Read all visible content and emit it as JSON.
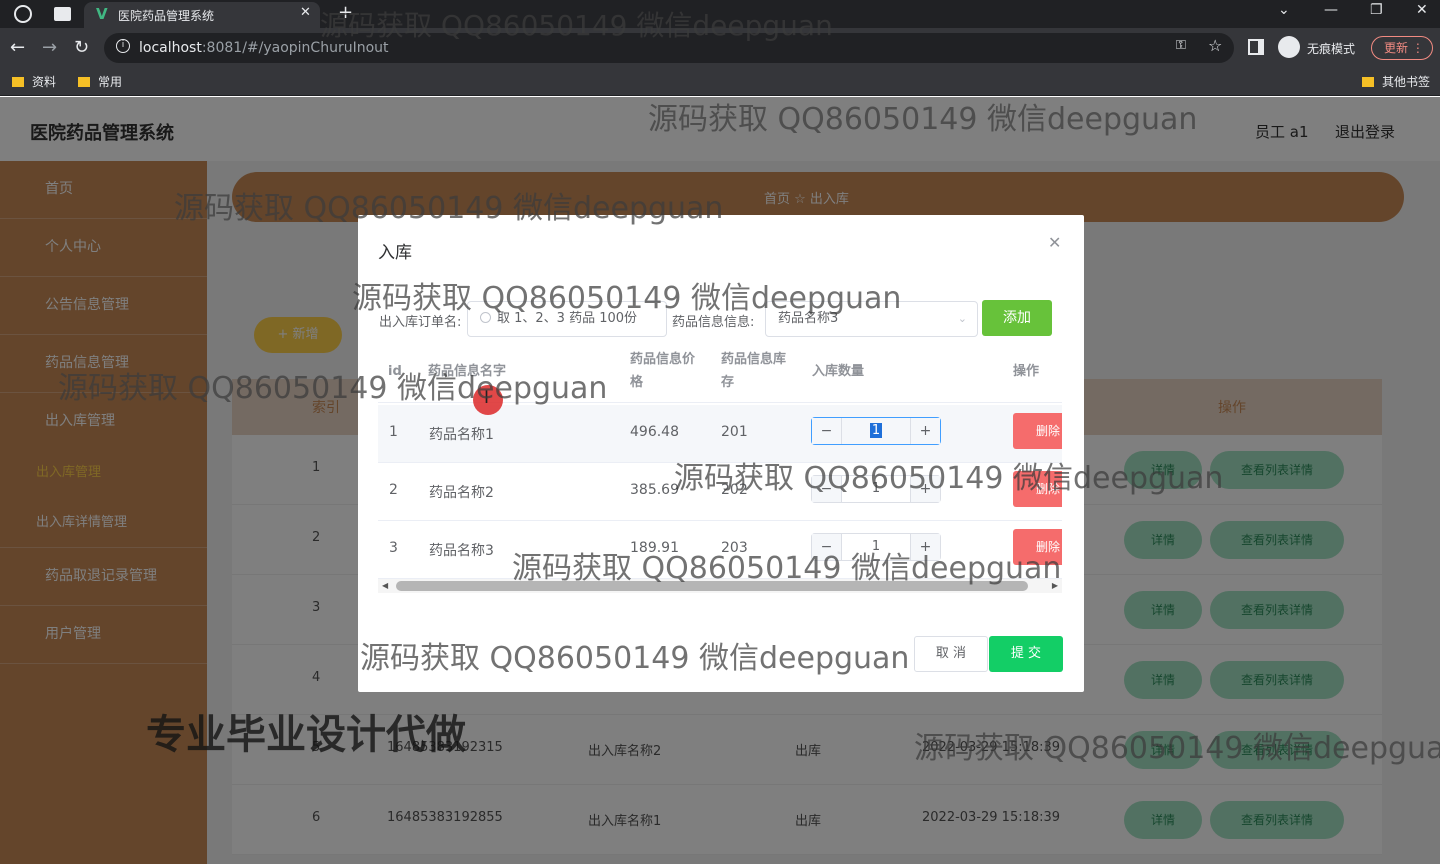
{
  "browser": {
    "tab_title": "医院药品管理系统",
    "url_host": "localhost",
    "url_path": ":8081/#/yaopinChuruInout",
    "incognito_label": "无痕模式",
    "update_label": "更新",
    "bookmarks": [
      "资料",
      "常用"
    ],
    "other_bookmarks": "其他书签"
  },
  "app": {
    "title": "医院药品管理系统",
    "user": "员工 a1",
    "logout": "退出登录",
    "sidebar": {
      "items": [
        "首页",
        "个人中心",
        "公告信息管理",
        "药品信息管理",
        "出入库管理"
      ],
      "subitems": [
        "出入库管理",
        "出入库详情管理"
      ],
      "items_after": [
        "药品取退记录管理",
        "用户管理"
      ]
    },
    "breadcrumb": "首页  ☆  出入库",
    "add_button": "+ 新增",
    "table": {
      "headers": [
        "索引",
        "操作"
      ],
      "row_indexes": [
        "1",
        "2",
        "3",
        "4"
      ],
      "rows": [
        {
          "index": "5",
          "code": "16485383192315",
          "name": "出入库名称2",
          "type": "出库",
          "time": "2022-03-29 15:18:39"
        },
        {
          "index": "6",
          "code": "16485383192855",
          "name": "出入库名称1",
          "type": "出库",
          "time": "2022-03-29 15:18:39"
        }
      ],
      "detail_btn": "详情",
      "list_detail_btn": "查看列表详情"
    }
  },
  "dialog": {
    "title": "入库",
    "order_label": "出入库订单名:",
    "order_value": "取 1、2、3 药品 100份",
    "drug_label": "药品信息信息:",
    "drug_value": "药品名称3",
    "add_label": "添加",
    "columns": {
      "id": "id",
      "name": "药品信息名字",
      "price_1": "药品信息价",
      "price_2": "格",
      "stock_1": "药品信息库",
      "stock_2": "存",
      "qty": "入库数量",
      "op": "操作"
    },
    "rows": [
      {
        "id": "1",
        "name": "药品名称1",
        "price": "496.48",
        "stock": "201",
        "qty": "1"
      },
      {
        "id": "2",
        "name": "药品名称2",
        "price": "385.69",
        "stock": "202",
        "qty": "1"
      },
      {
        "id": "3",
        "name": "药品名称3",
        "price": "189.91",
        "stock": "203",
        "qty": "1"
      }
    ],
    "delete_label": "删除",
    "cancel_label": "取 消",
    "submit_label": "提 交"
  },
  "watermark_text": "源码获取 QQ86050149 微信deepguan",
  "promo_text": "专业毕业设计代做"
}
